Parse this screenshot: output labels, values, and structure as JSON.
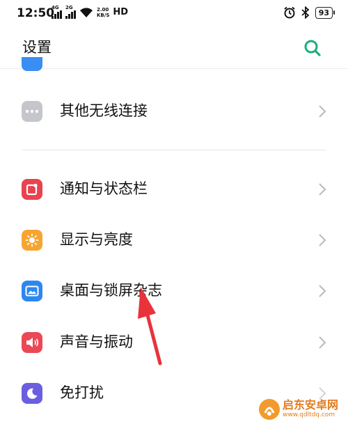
{
  "status_bar": {
    "time": "12:50",
    "signal1": "4G",
    "signal2": "2G",
    "speed_value": "2.00",
    "speed_unit": "KB/S",
    "hd": "HD",
    "battery": "93"
  },
  "header": {
    "title": "设置",
    "search_icon": "search-icon"
  },
  "settings": {
    "items": [
      {
        "label": "其他无线连接",
        "icon": "more-dots-icon",
        "color": "#c4c6cc"
      },
      {
        "label": "通知与状态栏",
        "icon": "notification-icon",
        "color": "#e8434f"
      },
      {
        "label": "显示与亮度",
        "icon": "brightness-icon",
        "color": "#f7a531"
      },
      {
        "label": "桌面与锁屏杂志",
        "icon": "wallpaper-icon",
        "color": "#2d87ef"
      },
      {
        "label": "声音与振动",
        "icon": "sound-icon",
        "color": "#ec4755"
      },
      {
        "label": "免打扰",
        "icon": "moon-icon",
        "color": "#6b5fe0"
      }
    ]
  },
  "watermark": {
    "title": "启东安卓网",
    "url": "www.qdltdq.com"
  },
  "colors": {
    "accent": "#1aae7a",
    "annotation_arrow": "#e8333b"
  }
}
